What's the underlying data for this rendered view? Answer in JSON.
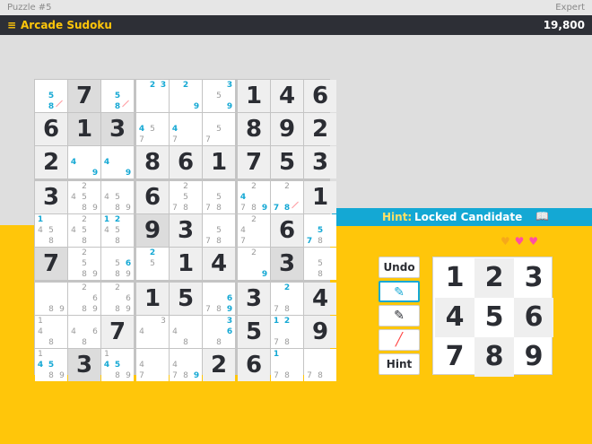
{
  "header": {
    "puzzle": "Puzzle #5",
    "difficulty": "Expert",
    "menu_icon": "≡",
    "app_title": "Arcade Sudoku",
    "score": "19,800"
  },
  "hint": {
    "key": "Hint:",
    "value": "Locked Candidate",
    "book_icon": "📖"
  },
  "lives": [
    "♥",
    "♥",
    "♥"
  ],
  "colors": {
    "accent": "#ffc60a",
    "hint": "#14a8d4",
    "dark": "#2d2f36"
  },
  "controls": {
    "undo": "Undo",
    "pen_icon": "✎",
    "eraser_icon": "╱",
    "hint": "Hint"
  },
  "numpad": [
    "1",
    "2",
    "3",
    "4",
    "5",
    "6",
    "7",
    "8",
    "9"
  ],
  "grid": {
    "cells": [
      [
        "",
        "7",
        "",
        "",
        "",
        "",
        "1",
        "4",
        "6"
      ],
      [
        "6",
        "1",
        "3",
        "",
        "",
        "",
        "8",
        "9",
        "2"
      ],
      [
        "2",
        "",
        "",
        "8",
        "6",
        "1",
        "7",
        "5",
        "3"
      ],
      [
        "3",
        "",
        "",
        "6",
        "",
        "",
        "",
        "",
        "1"
      ],
      [
        "",
        "",
        "",
        "9",
        "3",
        "",
        "",
        "6",
        ""
      ],
      [
        "7",
        "",
        "",
        "",
        "1",
        "4",
        "",
        "3",
        ""
      ],
      [
        "",
        "",
        "",
        "1",
        "5",
        "",
        "3",
        "",
        "4"
      ],
      [
        "",
        "",
        "7",
        "",
        "",
        "",
        "5",
        "",
        "9"
      ],
      [
        "",
        "3",
        "",
        "",
        "",
        "2",
        "6",
        "",
        ""
      ]
    ],
    "candidates": [
      [
        [
          "5",
          "8"
        ],
        [],
        [
          "5",
          "8"
        ],
        [
          "2",
          "3"
        ],
        [
          "2",
          "9"
        ],
        [
          "3",
          "5",
          "9"
        ],
        [],
        [],
        []
      ],
      [
        [],
        [],
        [],
        [
          "4",
          "5",
          "7"
        ],
        [
          "4",
          "7"
        ],
        [
          "5",
          "7"
        ],
        [],
        [],
        []
      ],
      [
        [],
        [
          "4",
          "9"
        ],
        [
          "4",
          "9"
        ],
        [],
        [],
        [],
        [],
        [],
        []
      ],
      [
        [],
        [
          "2",
          "4",
          "5",
          "8",
          "9"
        ],
        [
          "4",
          "5",
          "8",
          "9"
        ],
        [],
        [
          "2",
          "5",
          "7",
          "8"
        ],
        [
          "5",
          "7",
          "8"
        ],
        [
          "2",
          "4",
          "7",
          "8",
          "9"
        ],
        [
          "2",
          "7",
          "8"
        ],
        []
      ],
      [
        [
          "1",
          "4",
          "5",
          "8"
        ],
        [
          "2",
          "4",
          "5",
          "8"
        ],
        [
          "1",
          "2",
          "4",
          "5",
          "8"
        ],
        [],
        [],
        [
          "5",
          "7",
          "8"
        ],
        [
          "2",
          "4",
          "7"
        ],
        [],
        [
          "5",
          "7",
          "8"
        ]
      ],
      [
        [],
        [
          "2",
          "5",
          "8",
          "9"
        ],
        [
          "5",
          "6",
          "8",
          "9"
        ],
        [
          "2",
          "5"
        ],
        [],
        [],
        [
          "2",
          "9"
        ],
        [],
        [
          "5",
          "8"
        ]
      ],
      [
        [
          "8",
          "9"
        ],
        [
          "2",
          "6",
          "8",
          "9"
        ],
        [
          "2",
          "6",
          "8",
          "9"
        ],
        [],
        [],
        [
          "6",
          "7",
          "8",
          "9"
        ],
        [],
        [
          "2",
          "7",
          "8"
        ],
        []
      ],
      [
        [
          "1",
          "4",
          "8"
        ],
        [
          "4",
          "6",
          "8"
        ],
        [],
        [
          "3",
          "4"
        ],
        [
          "4",
          "8"
        ],
        [
          "3",
          "6",
          "8"
        ],
        [],
        [
          "1",
          "2",
          "7",
          "8"
        ],
        []
      ],
      [
        [
          "1",
          "4",
          "5",
          "8",
          "9"
        ],
        [],
        [
          "1",
          "4",
          "5",
          "8",
          "9"
        ],
        [
          "4",
          "7"
        ],
        [
          "4",
          "7",
          "8",
          "9"
        ],
        [],
        [],
        [
          "1",
          "7",
          "8"
        ],
        [
          "7",
          "8"
        ]
      ]
    ],
    "highlight": [
      [
        0,
        1,
        0,
        0,
        0,
        0,
        0,
        0,
        0
      ],
      [
        0,
        1,
        1,
        0,
        0,
        0,
        0,
        0,
        0
      ],
      [
        0,
        0,
        0,
        0,
        0,
        0,
        0,
        0,
        0
      ],
      [
        0,
        0,
        0,
        0,
        0,
        0,
        0,
        0,
        0
      ],
      [
        0,
        0,
        0,
        1,
        0,
        0,
        0,
        0,
        0
      ],
      [
        1,
        0,
        0,
        0,
        0,
        0,
        0,
        1,
        0
      ],
      [
        0,
        0,
        0,
        0,
        0,
        0,
        0,
        0,
        0
      ],
      [
        0,
        0,
        0,
        0,
        0,
        0,
        0,
        0,
        0
      ],
      [
        0,
        1,
        0,
        0,
        0,
        0,
        0,
        0,
        0
      ]
    ],
    "blue_candidates": [
      [
        "0-0-5",
        "0-0-8",
        "0-2-5",
        "0-2-8",
        "0-3-2",
        "0-3-3",
        "0-4-2",
        "0-4-9",
        "0-5-3",
        "0-5-9"
      ],
      [
        "1-3-4",
        "1-4-4"
      ],
      [
        "2-1-4",
        "2-1-9",
        "2-2-4",
        "2-2-9"
      ],
      [
        "3-6-4",
        "3-6-9",
        "3-7-7",
        "3-7-8"
      ],
      [
        "4-0-1",
        "4-2-1",
        "4-2-2",
        "4-8-5",
        "4-8-7"
      ],
      [
        "5-3-2",
        "5-5-9",
        "5-6-9",
        "5-2-6"
      ],
      [
        "6-5-6",
        "6-5-9",
        "6-7-2"
      ],
      [
        "7-4-3",
        "7-5-3",
        "7-5-6",
        "7-7-1",
        "7-7-2"
      ],
      [
        "8-7-1",
        "8-0-4",
        "8-0-5",
        "8-2-4",
        "8-2-5",
        "8-4-9"
      ]
    ]
  }
}
